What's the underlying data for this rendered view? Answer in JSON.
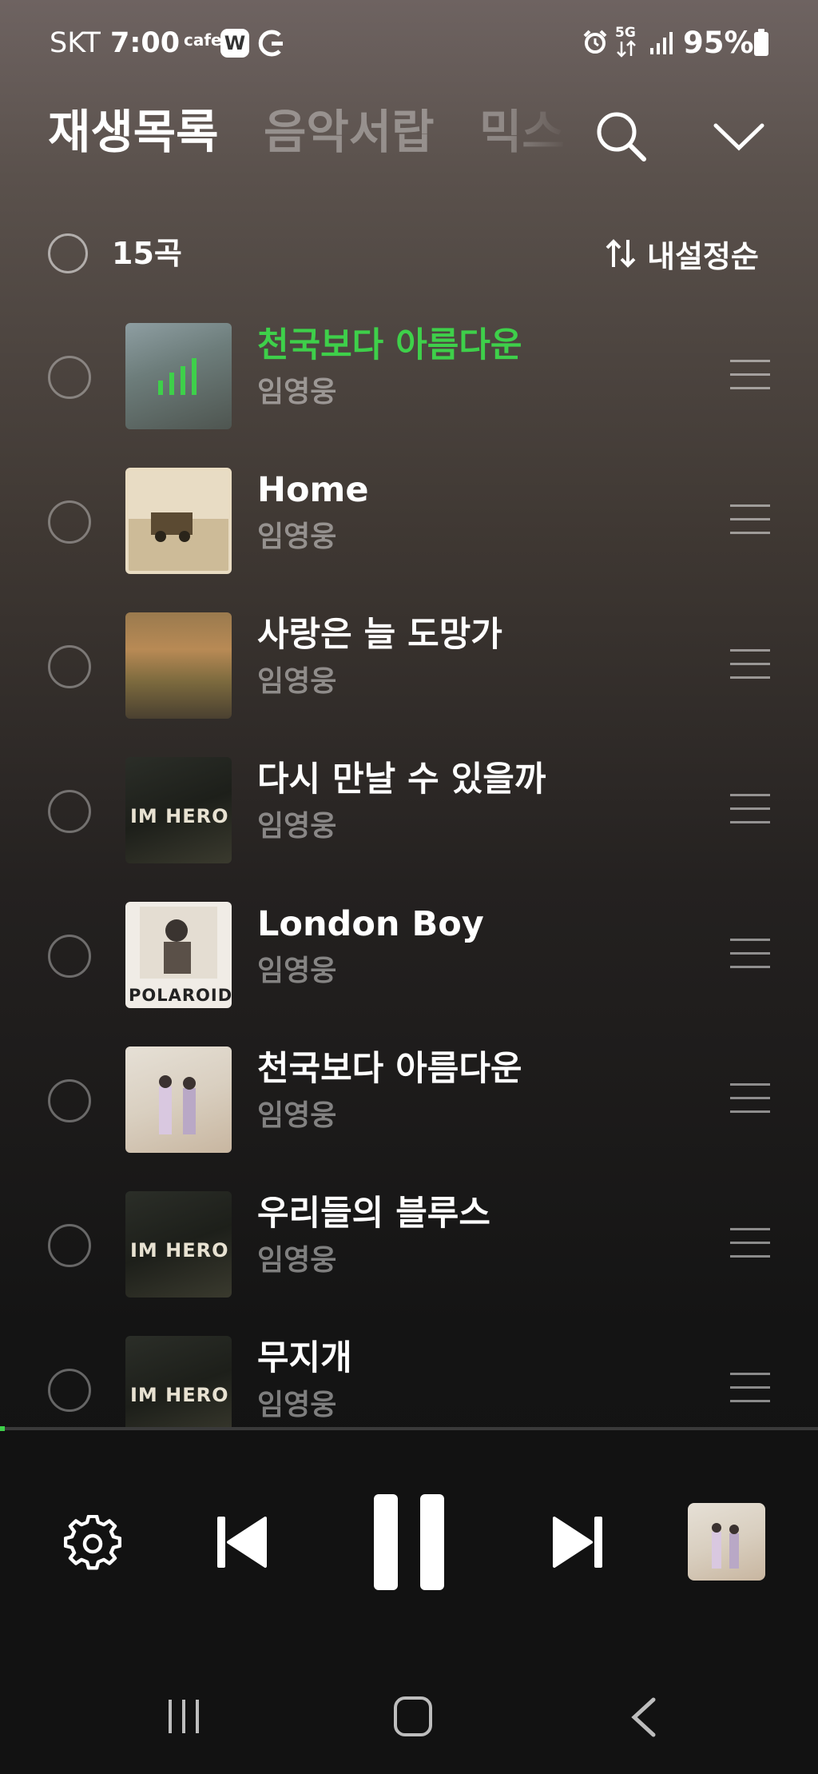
{
  "status_bar": {
    "carrier": "SKT",
    "time": "7:00",
    "cafe": "cafe",
    "w_badge": "W",
    "network": "5G",
    "battery": "95%"
  },
  "header": {
    "tabs": [
      "재생목록",
      "음악서랍",
      "믹스"
    ],
    "search_icon": "search-icon",
    "collapse_icon": "chevron-down-icon"
  },
  "list_header": {
    "count": "15곡",
    "sort_icon": "sort-arrows-icon",
    "sort_label": "내설정순"
  },
  "tracks": [
    {
      "title": "천국보다 아름다운",
      "artist": "임영웅",
      "playing": true
    },
    {
      "title": "Home",
      "artist": "임영웅",
      "playing": false
    },
    {
      "title": "사랑은 늘 도망가",
      "artist": "임영웅",
      "playing": false
    },
    {
      "title": "다시 만날 수 있을까",
      "artist": "임영웅",
      "playing": false
    },
    {
      "title": "London Boy",
      "artist": "임영웅",
      "playing": false
    },
    {
      "title": "천국보다 아름다운",
      "artist": "임영웅",
      "playing": false
    },
    {
      "title": "우리들의 블루스",
      "artist": "임영웅",
      "playing": false
    },
    {
      "title": "무지개",
      "artist": "임영웅",
      "playing": false
    }
  ],
  "album_text": {
    "im_hero": "IM HERO",
    "polaroid": "POLAROID"
  },
  "player": {
    "progress": 0.006,
    "accent_color": "#3ed04a",
    "controls": [
      "gear-icon",
      "previous-icon",
      "pause-icon",
      "next-icon"
    ]
  }
}
